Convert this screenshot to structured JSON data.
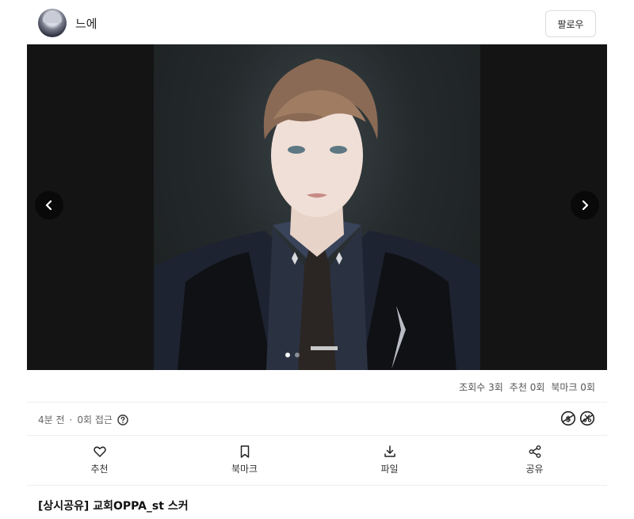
{
  "author": {
    "name": "느에",
    "follow_label": "팔로우"
  },
  "gallery": {
    "slide_count": 2,
    "active_slide": 1
  },
  "stats": {
    "views": "조회수 3회",
    "likes": "추천 0회",
    "bookmarks": "북마크 0회"
  },
  "meta": {
    "time_ago": "4분 전",
    "separator": "·",
    "access": "0회 접근"
  },
  "actions": [
    {
      "label": "추천",
      "icon": "heart-icon"
    },
    {
      "label": "북마크",
      "icon": "bookmark-icon"
    },
    {
      "label": "파일",
      "icon": "download-icon"
    },
    {
      "label": "공유",
      "icon": "share-icon"
    }
  ],
  "post": {
    "title": "[상시공유] 교회OPPA_st 스커"
  }
}
